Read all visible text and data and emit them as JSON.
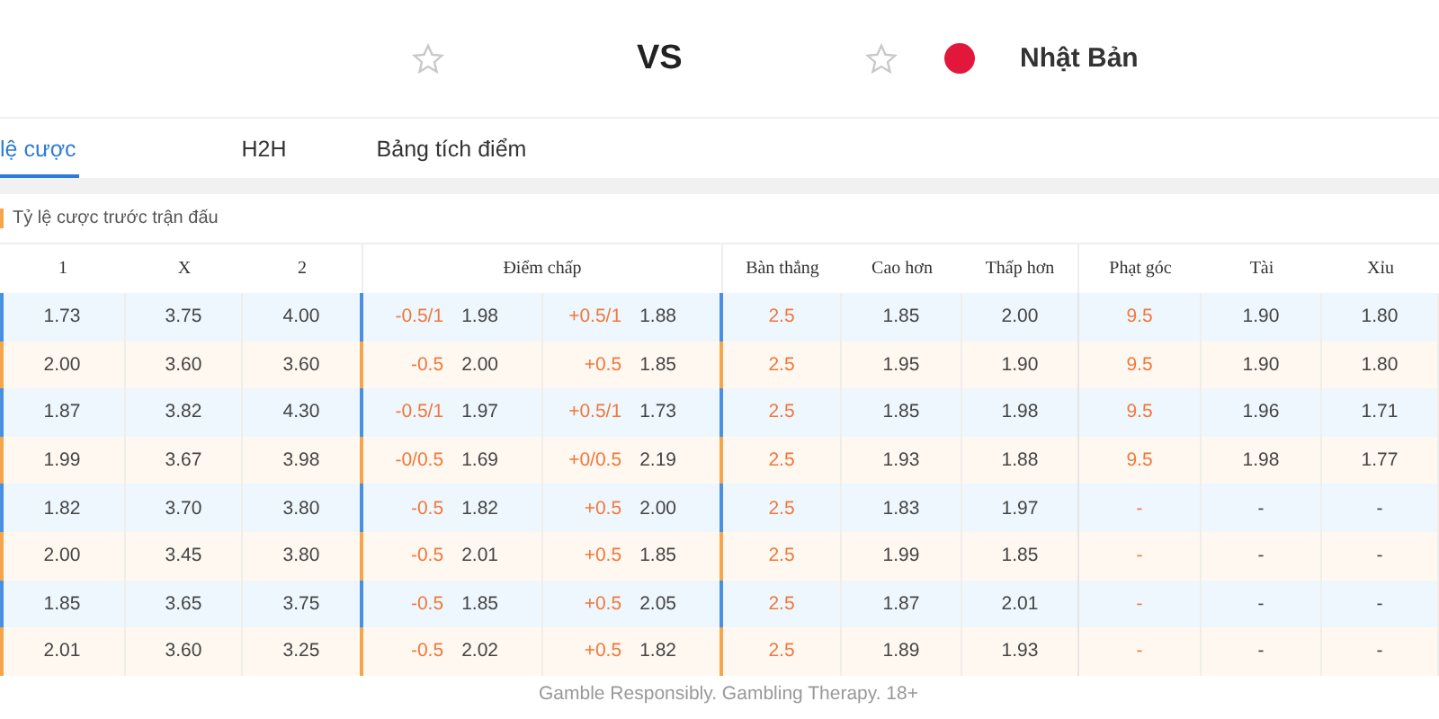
{
  "match": {
    "vs": "VS",
    "away": {
      "name": "Nhật Bản"
    }
  },
  "tabs": [
    {
      "label": "lệ cược",
      "selected": true
    },
    {
      "label": "H2H",
      "selected": false
    },
    {
      "label": "Bảng tích điểm",
      "selected": false
    }
  ],
  "section_title": "Tỷ lệ cược trước trận đấu",
  "columns": [
    "1",
    "X",
    "2",
    "Điểm chấp",
    "Bàn thắng",
    "Cao hơn",
    "Thấp hơn",
    "Phạt góc",
    "Tài",
    "Xỉu"
  ],
  "rows": [
    {
      "color": "#4a90e2",
      "home": "1.73",
      "draw": "3.75",
      "away": "4.00",
      "hcap_home": {
        "line": "-0.5/1",
        "odds": "1.98"
      },
      "hcap_away": {
        "line": "+0.5/1",
        "odds": "1.88"
      },
      "goals": "2.5",
      "over": "1.85",
      "under": "2.00",
      "corners": "9.5",
      "tai": "1.90",
      "xiu": "1.80"
    },
    {
      "color": "#f5a64a",
      "home": "2.00",
      "draw": "3.60",
      "away": "3.60",
      "hcap_home": {
        "line": "-0.5",
        "odds": "2.00"
      },
      "hcap_away": {
        "line": "+0.5",
        "odds": "1.85"
      },
      "goals": "2.5",
      "over": "1.95",
      "under": "1.90",
      "corners": "9.5",
      "tai": "1.90",
      "xiu": "1.80"
    },
    {
      "color": "#4a90e2",
      "home": "1.87",
      "draw": "3.82",
      "away": "4.30",
      "hcap_home": {
        "line": "-0.5/1",
        "odds": "1.97"
      },
      "hcap_away": {
        "line": "+0.5/1",
        "odds": "1.73"
      },
      "goals": "2.5",
      "over": "1.85",
      "under": "1.98",
      "corners": "9.5",
      "tai": "1.96",
      "xiu": "1.71"
    },
    {
      "color": "#f5a64a",
      "home": "1.99",
      "draw": "3.67",
      "away": "3.98",
      "hcap_home": {
        "line": "-0/0.5",
        "odds": "1.69"
      },
      "hcap_away": {
        "line": "+0/0.5",
        "odds": "2.19"
      },
      "goals": "2.5",
      "over": "1.93",
      "under": "1.88",
      "corners": "9.5",
      "tai": "1.98",
      "xiu": "1.77"
    },
    {
      "color": "#4a90e2",
      "home": "1.82",
      "draw": "3.70",
      "away": "3.80",
      "hcap_home": {
        "line": "-0.5",
        "odds": "1.82"
      },
      "hcap_away": {
        "line": "+0.5",
        "odds": "2.00"
      },
      "goals": "2.5",
      "over": "1.83",
      "under": "1.97",
      "corners": "-",
      "tai": "-",
      "xiu": "-"
    },
    {
      "color": "#f5a64a",
      "home": "2.00",
      "draw": "3.45",
      "away": "3.80",
      "hcap_home": {
        "line": "-0.5",
        "odds": "2.01"
      },
      "hcap_away": {
        "line": "+0.5",
        "odds": "1.85"
      },
      "goals": "2.5",
      "over": "1.99",
      "under": "1.85",
      "corners": "-",
      "tai": "-",
      "xiu": "-"
    },
    {
      "color": "#4a90e2",
      "home": "1.85",
      "draw": "3.65",
      "away": "3.75",
      "hcap_home": {
        "line": "-0.5",
        "odds": "1.85"
      },
      "hcap_away": {
        "line": "+0.5",
        "odds": "2.05"
      },
      "goals": "2.5",
      "over": "1.87",
      "under": "2.01",
      "corners": "-",
      "tai": "-",
      "xiu": "-"
    },
    {
      "color": "#f5a64a",
      "home": "2.01",
      "draw": "3.60",
      "away": "3.25",
      "hcap_home": {
        "line": "-0.5",
        "odds": "2.02"
      },
      "hcap_away": {
        "line": "+0.5",
        "odds": "1.82"
      },
      "goals": "2.5",
      "over": "1.89",
      "under": "1.93",
      "corners": "-",
      "tai": "-",
      "xiu": "-"
    }
  ],
  "footer": "Gamble Responsibly. Gambling Therapy. 18+"
}
